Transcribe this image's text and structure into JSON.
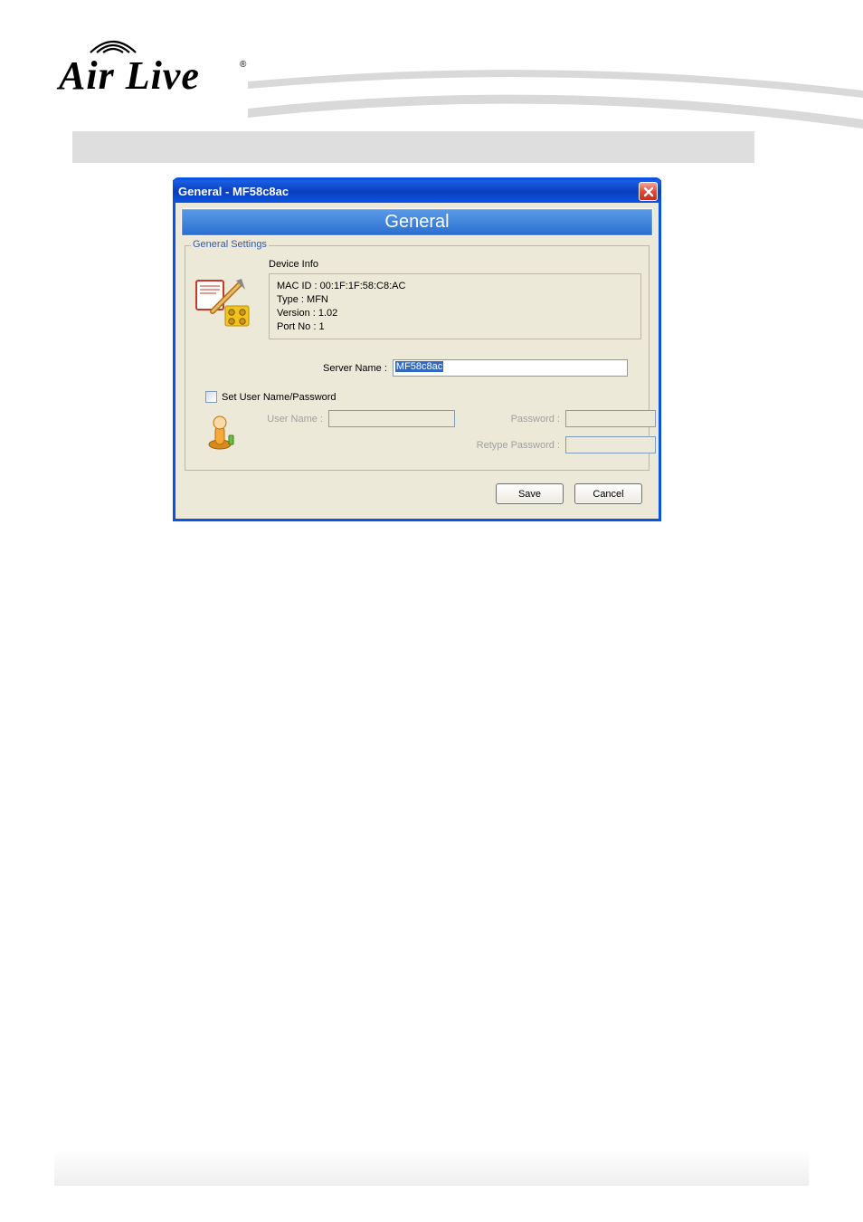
{
  "brand": {
    "name": "Air Live",
    "registered": "®"
  },
  "dialog": {
    "title": "General - MF58c8ac",
    "panel_title": "General",
    "fieldset_legend": "General Settings",
    "device_info": {
      "label": "Device Info",
      "mac_label": "MAC ID : ",
      "mac_value": "00:1F:1F:58:C8:AC",
      "type_label": "Type : ",
      "type_value": "MFN",
      "version_label": "Version : ",
      "version_value": "1.02",
      "port_label": "Port No : ",
      "port_value": "1"
    },
    "server_name": {
      "label": "Server Name :",
      "value": "MF58c8ac"
    },
    "credentials": {
      "checkbox_label": "Set User Name/Password",
      "checked": false,
      "user_label": "User Name :",
      "user_value": "",
      "password_label": "Password :",
      "password_value": "",
      "retype_label": "Retype Password :",
      "retype_value": ""
    },
    "buttons": {
      "save": "Save",
      "cancel": "Cancel"
    }
  }
}
